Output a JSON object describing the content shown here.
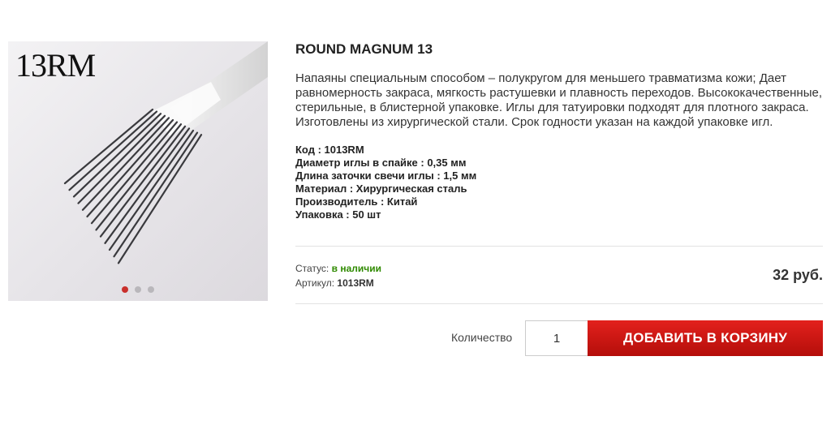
{
  "product": {
    "image_label": "13RM",
    "title": "ROUND MAGNUM 13",
    "description": "Напаяны специальным способом – полукругом для меньшего травматизма кожи; Дает равномерность закраса, мягкость растушевки и плавность переходов. Высококачественные, стерильные, в блистерной упаковке. Иглы для татуировки подходят для плотного закраса. Изготовлены из хирургической стали. Срок годности указан на каждой упаковке игл.",
    "specs": [
      "Код : 1013RM",
      "Диаметр иглы в спайке : 0,35 мм",
      "Длина заточки свечи иглы : 1,5 мм",
      "Материал : Хирургическая сталь",
      "Производитель : Китай",
      "Упаковка : 50 шт"
    ],
    "status_label": "Статус:",
    "status_value": "в наличии",
    "sku_label": "Артикул:",
    "sku_value": "1013RM",
    "price": "32 руб.",
    "quantity_label": "Количество",
    "quantity_value": "1",
    "add_to_cart_label": "ДОБАВИТЬ В КОРЗИНУ"
  },
  "gallery": {
    "slide_count": 3,
    "active_slide": 1
  },
  "colors": {
    "accent_red": "#d4231f",
    "status_green": "#2f8a00",
    "active_dot": "#c9302c"
  }
}
